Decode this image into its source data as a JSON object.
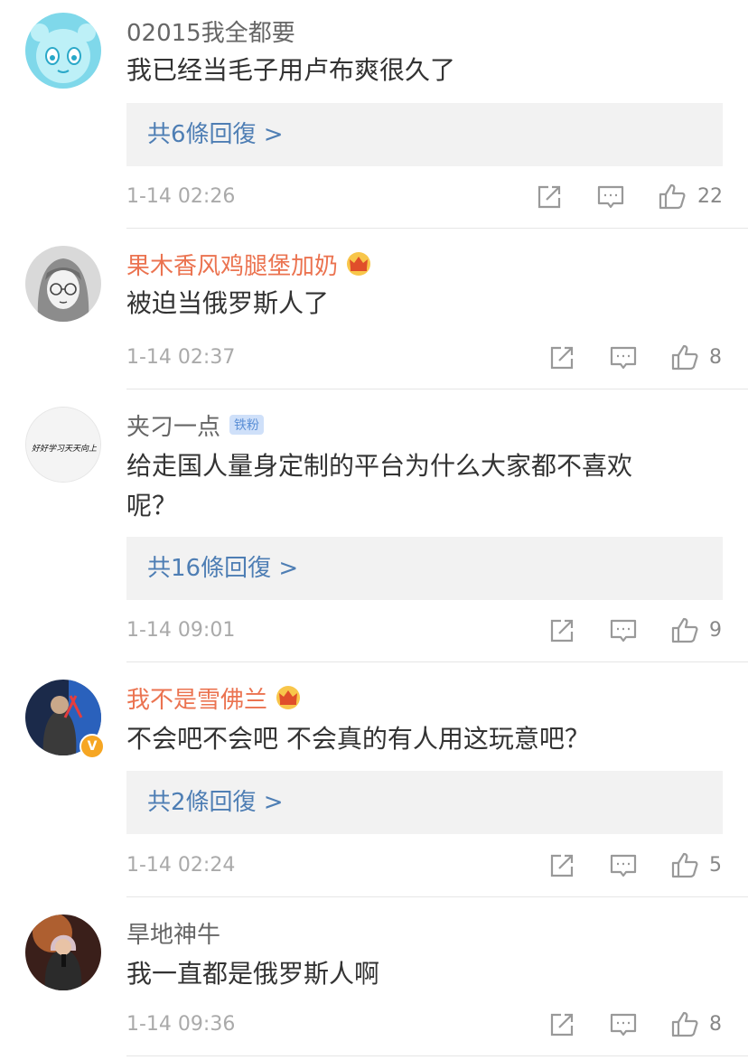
{
  "comments": [
    {
      "username": "02015我全都要",
      "text": "我已经当毛子用卢布爽很久了",
      "replies_label": "共6條回復 >",
      "time": "1-14 02:26",
      "likes": "22"
    },
    {
      "username": "果木香风鸡腿堡加奶",
      "text": "被迫当俄罗斯人了",
      "time": "1-14 02:37",
      "likes": "8"
    },
    {
      "username": "夹刁一点",
      "fan_badge": "铁粉",
      "avatar_text": "好好学习天天向上",
      "text_line1": "给走国人量身定制的平台为什么大家都不喜欢",
      "text_line2": "呢？",
      "replies_label": "共16條回復 >",
      "time": "1-14 09:01",
      "likes": "9"
    },
    {
      "username": "我不是雪佛兰",
      "verified_badge": "V",
      "text": "不会吧不会吧 不会真的有人用这玩意吧？",
      "replies_label": "共2條回復 >",
      "time": "1-14 02:24",
      "likes": "5"
    },
    {
      "username": "旱地神牛",
      "text": "我一直都是俄罗斯人啊",
      "time": "1-14 09:36",
      "likes": "8"
    }
  ],
  "icons": {
    "share": "share-icon",
    "comment": "comment-icon",
    "like": "thumbs-up-icon",
    "crown": "crown-icon"
  },
  "colors": {
    "vip_name": "#eb7350",
    "reply_link": "#4e7eb4",
    "badge_gold": "#f6a623"
  }
}
